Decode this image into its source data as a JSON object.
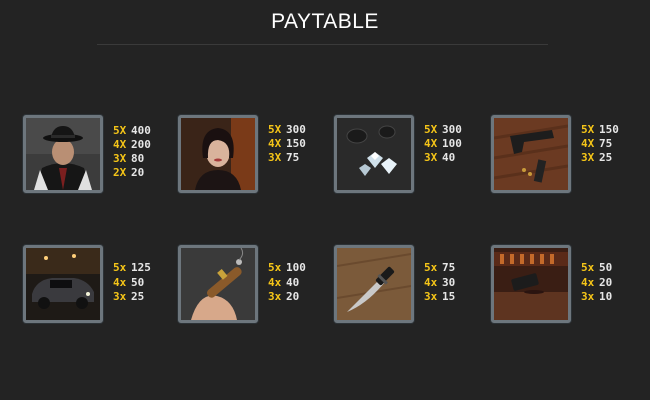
{
  "title": "PAYTABLE",
  "colors": {
    "background": "#232323",
    "multiplier": "#f5c518",
    "amount": "#e6e6e6",
    "frame": "#6d767d"
  },
  "symbols": [
    {
      "icon": "gangster-icon",
      "pays": [
        {
          "mult": "5X",
          "amount": "400"
        },
        {
          "mult": "4X",
          "amount": "200"
        },
        {
          "mult": "3X",
          "amount": "80"
        },
        {
          "mult": "2X",
          "amount": "20"
        }
      ]
    },
    {
      "icon": "woman-icon",
      "pays": [
        {
          "mult": "5X",
          "amount": "300"
        },
        {
          "mult": "4X",
          "amount": "150"
        },
        {
          "mult": "3X",
          "amount": "75"
        }
      ]
    },
    {
      "icon": "diamonds-icon",
      "pays": [
        {
          "mult": "5X",
          "amount": "300"
        },
        {
          "mult": "4X",
          "amount": "100"
        },
        {
          "mult": "3X",
          "amount": "40"
        }
      ]
    },
    {
      "icon": "pistol-icon",
      "pays": [
        {
          "mult": "5X",
          "amount": "150"
        },
        {
          "mult": "4X",
          "amount": "75"
        },
        {
          "mult": "3X",
          "amount": "25"
        }
      ]
    },
    {
      "icon": "car-icon",
      "pays": [
        {
          "mult": "5x",
          "amount": "125"
        },
        {
          "mult": "4x",
          "amount": "50"
        },
        {
          "mult": "3x",
          "amount": "25"
        }
      ]
    },
    {
      "icon": "cigar-icon",
      "pays": [
        {
          "mult": "5x",
          "amount": "100"
        },
        {
          "mult": "4x",
          "amount": "40"
        },
        {
          "mult": "3x",
          "amount": "20"
        }
      ]
    },
    {
      "icon": "knife-icon",
      "pays": [
        {
          "mult": "5x",
          "amount": "75"
        },
        {
          "mult": "4x",
          "amount": "30"
        },
        {
          "mult": "3x",
          "amount": "15"
        }
      ]
    },
    {
      "icon": "bar-counter-icon",
      "pays": [
        {
          "mult": "5x",
          "amount": "50"
        },
        {
          "mult": "4x",
          "amount": "20"
        },
        {
          "mult": "3x",
          "amount": "10"
        }
      ]
    }
  ]
}
